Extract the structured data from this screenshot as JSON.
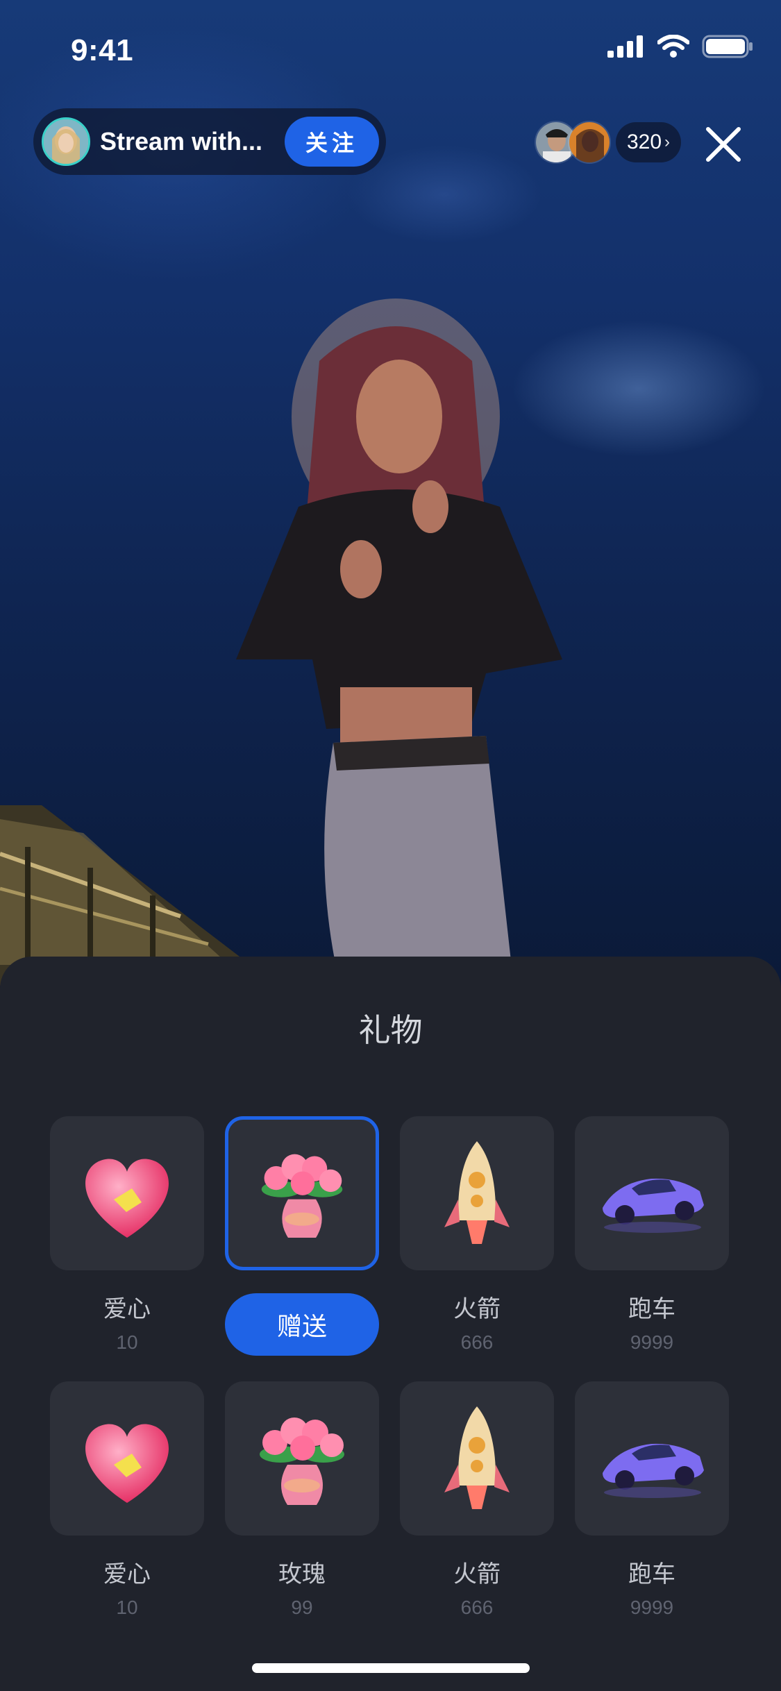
{
  "status_bar": {
    "time": "9:41"
  },
  "header": {
    "host_name": "Stream with...",
    "follow_label": "关注",
    "viewer_count": "320",
    "chevron": "›"
  },
  "icons": {
    "signal": "signal-icon",
    "wifi": "wifi-icon",
    "battery": "battery-icon",
    "close": "close-icon"
  },
  "sheet": {
    "title": "礼物",
    "send_label": "赠送",
    "gifts": [
      {
        "name": "爱心",
        "price": "10",
        "icon": "heart-gift-icon"
      },
      {
        "name": "玫瑰",
        "price": "99",
        "icon": "rose-vase-gift-icon",
        "selected": true
      },
      {
        "name": "火箭",
        "price": "666",
        "icon": "rocket-gift-icon"
      },
      {
        "name": "跑车",
        "price": "9999",
        "icon": "sports-car-gift-icon"
      },
      {
        "name": "爱心",
        "price": "10",
        "icon": "heart-gift-icon"
      },
      {
        "name": "玫瑰",
        "price": "99",
        "icon": "rose-vase-gift-icon"
      },
      {
        "name": "火箭",
        "price": "666",
        "icon": "rocket-gift-icon"
      },
      {
        "name": "跑车",
        "price": "9999",
        "icon": "sports-car-gift-icon"
      }
    ]
  },
  "colors": {
    "accent": "#1f63e6",
    "sheet_bg": "#20232c",
    "card_bg": "#2d3039"
  }
}
